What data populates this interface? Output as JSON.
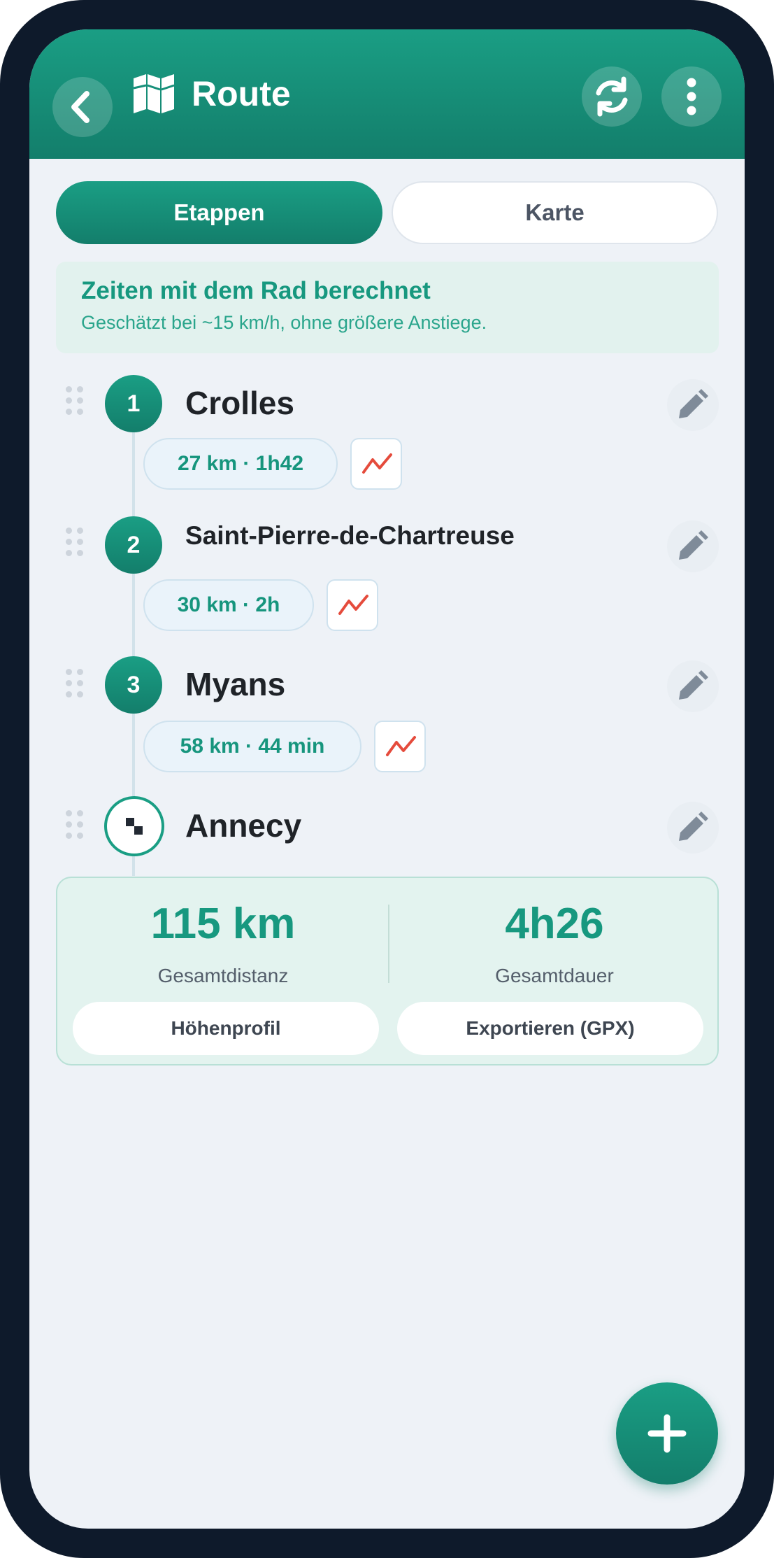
{
  "header": {
    "title": "Route",
    "icons": {
      "back": "chevron-left-icon",
      "map": "map-icon",
      "refresh": "refresh-icon",
      "more": "more-vertical-icon"
    }
  },
  "tabs": [
    {
      "label": "Etappen",
      "active": true
    },
    {
      "label": "Karte",
      "active": false
    }
  ],
  "info": {
    "title": "Zeiten mit dem Rad berechnet",
    "subtitle": "Geschätzt bei ~15 km/h, ohne größere Anstiege."
  },
  "stages": [
    {
      "number": "1",
      "name": "Crolles",
      "leg": "27 km · 1h42"
    },
    {
      "number": "2",
      "name": "Saint-Pierre-de-Chartreuse",
      "leg": "30 km · 2h"
    },
    {
      "number": "3",
      "name": "Myans",
      "leg": "58 km · 44 min"
    },
    {
      "name": "Annecy",
      "marker": "finish-flag-icon"
    }
  ],
  "summary": {
    "distance_value": "115 km",
    "distance_label": "Gesamtdistanz",
    "duration_value": "4h26",
    "duration_label": "Gesamtdauer",
    "profile_button": "Höhenprofil",
    "export_button": "Exportieren (GPX)"
  },
  "fab": {
    "icon": "plus-icon"
  },
  "colors": {
    "accent": "#1a9e84",
    "accent_dark": "#137e6b",
    "elevation_line": "#e54b3c",
    "background": "#eef2f7"
  }
}
